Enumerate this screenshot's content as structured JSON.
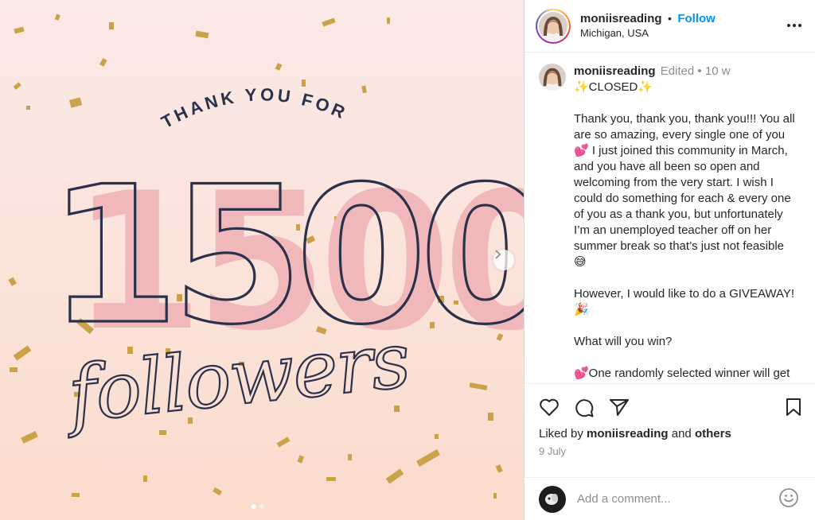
{
  "post": {
    "image_text": {
      "thank_you": "THANK YOU FOR",
      "number": "1500",
      "followers": "followers"
    }
  },
  "header": {
    "username": "moniisreading",
    "separator": "•",
    "follow_label": "Follow",
    "location": "Michigan, USA"
  },
  "caption": {
    "username": "moniisreading",
    "edited": "Edited",
    "dot": "•",
    "time": "10 w",
    "title": "✨CLOSED✨",
    "paragraphs": [
      "Thank you, thank you, thank you!!! You all are so amazing, every single one of you 💕 I just joined this community in March, and you have all been so open and welcoming from the very start. I wish I could do something for each & every one of you as a thank you, but unfortunately I’m an unemployed teacher off on her summer break so that’s just not feasible 😅",
      "However, I would like to do a GIVEAWAY! 🎉",
      "What will you win?",
      "💕One randomly selected winner will get a book off of their Amazon wish list"
    ]
  },
  "likes": {
    "prefix": "Liked by",
    "user": "moniisreading",
    "and": "and",
    "others": "others"
  },
  "date": "9 July",
  "comment": {
    "placeholder": "Add a comment..."
  },
  "colors": {
    "follow_blue": "#0095f6",
    "number_pink": "#f0b8bb",
    "outline_navy": "#2b3149",
    "confetti_gold": "#c9a24a"
  },
  "icons": [
    "heart-icon",
    "comment-icon",
    "share-icon",
    "bookmark-icon",
    "emoji-icon",
    "more-icon",
    "chevron-right-icon"
  ]
}
